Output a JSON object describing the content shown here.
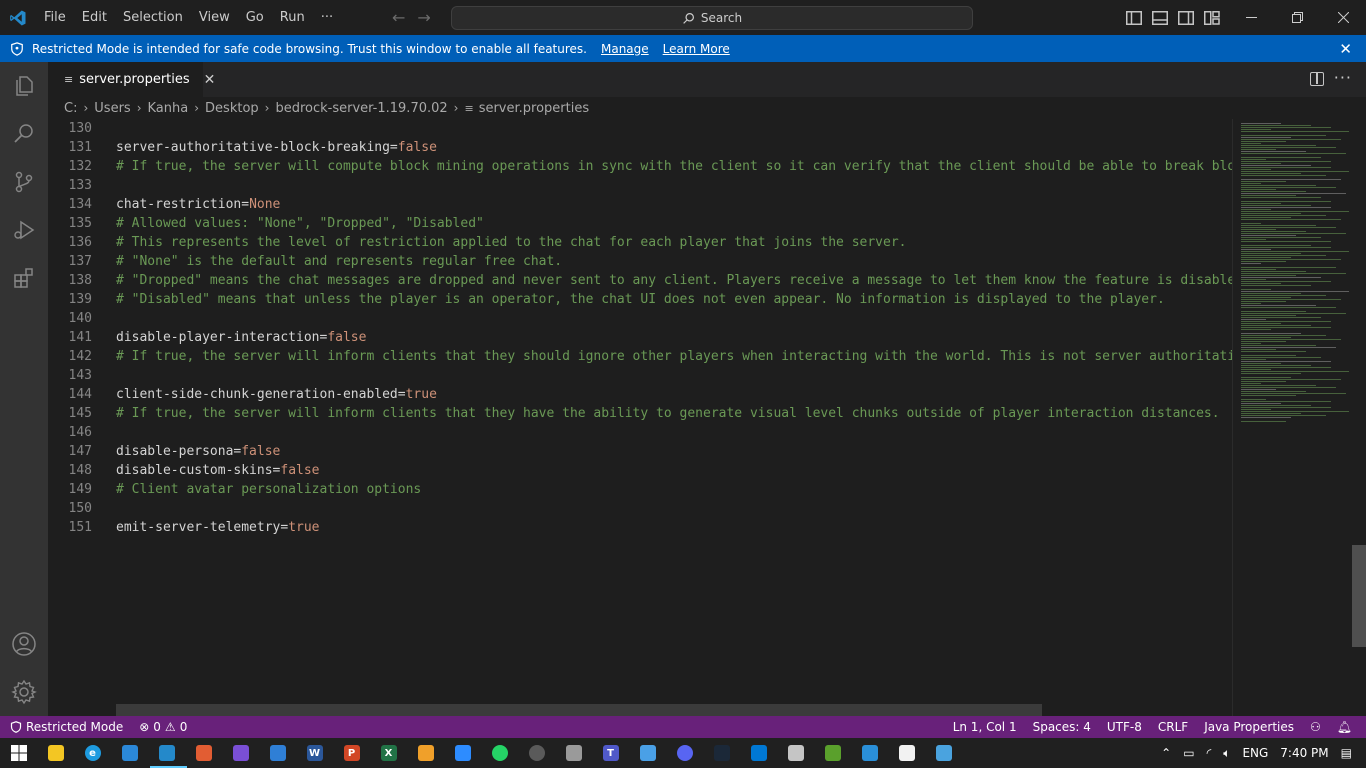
{
  "titlebar": {
    "menu": [
      "File",
      "Edit",
      "Selection",
      "View",
      "Go",
      "Run",
      "···"
    ],
    "search_label": "Search"
  },
  "banner": {
    "message": "Restricted Mode is intended for safe code browsing. Trust this window to enable all features.",
    "manage": "Manage",
    "learn_more": "Learn More"
  },
  "tab": {
    "label": "server.properties"
  },
  "breadcrumb": [
    "C:",
    "Users",
    "Kanha",
    "Desktop",
    "bedrock-server-1.19.70.02",
    "server.properties"
  ],
  "editor": {
    "lines": [
      {
        "n": "130",
        "key": "",
        "val": "",
        "comment": ""
      },
      {
        "n": "131",
        "key": "server-authoritative-block-breaking=",
        "val": "false",
        "comment": ""
      },
      {
        "n": "132",
        "key": "",
        "val": "",
        "comment": "# If true, the server will compute block mining operations in sync with the client so it can verify that the client should be able to break block"
      },
      {
        "n": "133",
        "key": "",
        "val": "",
        "comment": ""
      },
      {
        "n": "134",
        "key": "chat-restriction=",
        "val": "None",
        "comment": ""
      },
      {
        "n": "135",
        "key": "",
        "val": "",
        "comment": "# Allowed values: \"None\", \"Dropped\", \"Disabled\""
      },
      {
        "n": "136",
        "key": "",
        "val": "",
        "comment": "# This represents the level of restriction applied to the chat for each player that joins the server."
      },
      {
        "n": "137",
        "key": "",
        "val": "",
        "comment": "# \"None\" is the default and represents regular free chat."
      },
      {
        "n": "138",
        "key": "",
        "val": "",
        "comment": "# \"Dropped\" means the chat messages are dropped and never sent to any client. Players receive a message to let them know the feature is disabled."
      },
      {
        "n": "139",
        "key": "",
        "val": "",
        "comment": "# \"Disabled\" means that unless the player is an operator, the chat UI does not even appear. No information is displayed to the player."
      },
      {
        "n": "140",
        "key": "",
        "val": "",
        "comment": ""
      },
      {
        "n": "141",
        "key": "disable-player-interaction=",
        "val": "false",
        "comment": ""
      },
      {
        "n": "142",
        "key": "",
        "val": "",
        "comment": "# If true, the server will inform clients that they should ignore other players when interacting with the world. This is not server authoritative"
      },
      {
        "n": "143",
        "key": "",
        "val": "",
        "comment": ""
      },
      {
        "n": "144",
        "key": "client-side-chunk-generation-enabled=",
        "val": "true",
        "comment": ""
      },
      {
        "n": "145",
        "key": "",
        "val": "",
        "comment": "# If true, the server will inform clients that they have the ability to generate visual level chunks outside of player interaction distances."
      },
      {
        "n": "146",
        "key": "",
        "val": "",
        "comment": ""
      },
      {
        "n": "147",
        "key": "disable-persona=",
        "val": "false",
        "comment": ""
      },
      {
        "n": "148",
        "key": "disable-custom-skins=",
        "val": "false",
        "comment": ""
      },
      {
        "n": "149",
        "key": "",
        "val": "",
        "comment": "# Client avatar personalization options"
      },
      {
        "n": "150",
        "key": "",
        "val": "",
        "comment": ""
      },
      {
        "n": "151",
        "key": "emit-server-telemetry=",
        "val": "true",
        "comment": ""
      }
    ]
  },
  "statusbar": {
    "restricted": "Restricted Mode",
    "errors": "0",
    "warnings": "0",
    "position": "Ln 1, Col 1",
    "spaces": "Spaces: 4",
    "encoding": "UTF-8",
    "eol": "CRLF",
    "language": "Java Properties"
  },
  "taskbar": {
    "lang": "ENG",
    "time": "7:40 PM",
    "icons": [
      "explorer-icon",
      "edge-icon",
      "store-icon",
      "vscode-icon",
      "office-icon",
      "clipchamp-icon",
      "mail-icon",
      "word-icon",
      "powerpoint-icon",
      "excel-icon",
      "files-icon",
      "zoom-icon",
      "whatsapp-icon",
      "obs-icon",
      "usb-icon",
      "teams-icon",
      "remote-desktop-icon",
      "discord-icon",
      "steam-icon",
      "photos-icon",
      "settings-icon",
      "minecraft-icon",
      "vpn-icon",
      "shield-app-icon",
      "notepad-icon"
    ]
  },
  "colors": {
    "statusbar": "#68217a",
    "banner": "#005fb8",
    "comment": "#6a9955",
    "value": "#ce9178"
  }
}
